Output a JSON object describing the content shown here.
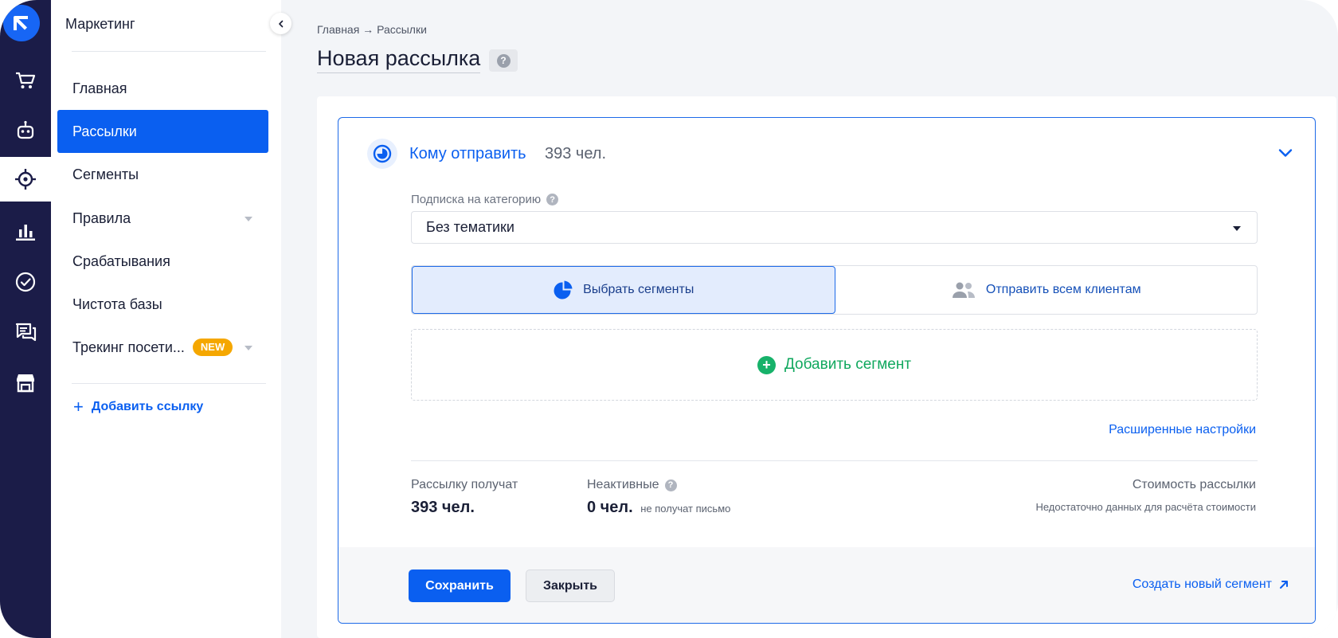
{
  "sidebar": {
    "title": "Маркетинг",
    "items": [
      {
        "label": "Главная"
      },
      {
        "label": "Рассылки"
      },
      {
        "label": "Сегменты"
      },
      {
        "label": "Правила"
      },
      {
        "label": "Срабатывания"
      },
      {
        "label": "Чистота базы"
      },
      {
        "label": "Трекинг посети...",
        "badge": "NEW"
      }
    ],
    "add_link": "Добавить ссылку"
  },
  "rail": {
    "icons": [
      "logo-icon",
      "cart-icon",
      "bot-icon",
      "target-icon",
      "analytics-icon",
      "check-circle-icon",
      "chat-icon",
      "store-icon"
    ],
    "active": "target-icon"
  },
  "header": {
    "breadcrumb": "Главная → Рассылки",
    "title": "Новая рассылка",
    "help": "?"
  },
  "panel": {
    "title": "Кому отправить",
    "count": "393 чел.",
    "category_label": "Подписка на категорию",
    "category_value": "Без тематики",
    "toggle": {
      "segments": "Выбрать сегменты",
      "all_clients": "Отправить всем клиентам"
    },
    "add_segment": "Добавить сегмент",
    "advanced_link": "Расширенные настройки",
    "stats": {
      "recipients_label": "Рассылку получат",
      "recipients_value": "393 чел.",
      "inactive_label": "Неактивные",
      "inactive_value": "0 чел.",
      "inactive_note": "не получат письмо",
      "cost_label": "Стоимость рассылки",
      "cost_note": "Недостаточно данных для расчёта стоимости"
    },
    "footer": {
      "save": "Сохранить",
      "close": "Закрыть",
      "new_segment": "Создать новый сегмент"
    }
  },
  "colors": {
    "accent": "#0a5ff0",
    "rail": "#1b1c48",
    "success": "#17b26a",
    "badge": "#f5a700"
  }
}
